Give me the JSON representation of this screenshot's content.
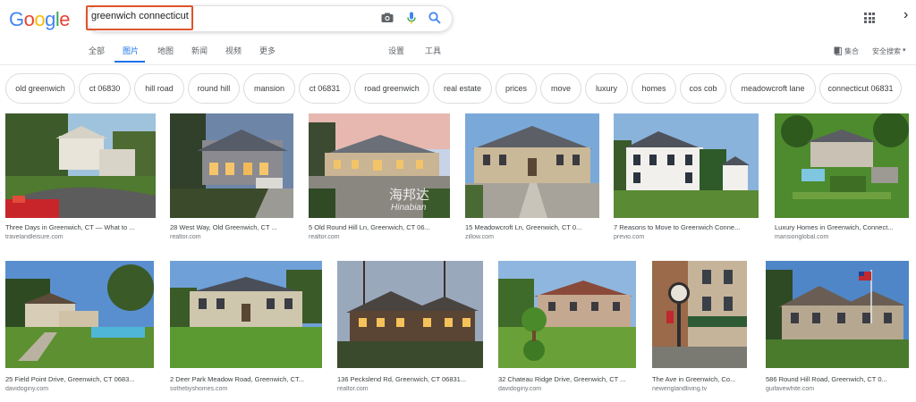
{
  "logo": {
    "letters": [
      "G",
      "o",
      "o",
      "g",
      "l",
      "e"
    ],
    "colors": [
      "#4285f4",
      "#ea4335",
      "#fbbc05",
      "#4285f4",
      "#34a853",
      "#ea4335"
    ]
  },
  "search": {
    "query": "greenwich connecticut"
  },
  "tabs": [
    {
      "label": "全部",
      "active": false
    },
    {
      "label": "图片",
      "active": true
    },
    {
      "label": "地图",
      "active": false
    },
    {
      "label": "新闻",
      "active": false
    },
    {
      "label": "视频",
      "active": false
    },
    {
      "label": "更多",
      "active": false
    },
    {
      "label": "设置",
      "active": false
    },
    {
      "label": "工具",
      "active": false
    }
  ],
  "header_right": {
    "collections": "集合",
    "safesearch": "安全搜索"
  },
  "chips": [
    "old greenwich",
    "ct 06830",
    "hill road",
    "round hill",
    "mansion",
    "ct 06831",
    "road greenwich",
    "real estate",
    "prices",
    "move",
    "luxury",
    "homes",
    "cos cob",
    "meadowcroft lane",
    "connecticut 06831"
  ],
  "results": [
    {
      "caption": "Three Days in Greenwich, CT — What to ...",
      "source": "travelandleisure.com"
    },
    {
      "caption": "28 West Way, Old Greenwich, CT ...",
      "source": "realtor.com"
    },
    {
      "caption": "5 Old Round Hill Ln, Greenwich, CT 06...",
      "source": "realtor.com"
    },
    {
      "caption": "15 Meadowcroft Ln, Greenwich, CT 0...",
      "source": "zillow.com"
    },
    {
      "caption": "7 Reasons to Move to Greenwich Conne...",
      "source": "previo.com"
    },
    {
      "caption": "Luxury Homes in Greenwich, Connect...",
      "source": "mansionglobal.com"
    },
    {
      "caption": "25 Field Point Drive, Greenwich, CT 0683...",
      "source": "davidoginy.com"
    },
    {
      "caption": "2 Deer Park Meadow Road, Greenwich, CT...",
      "source": "sothebyshomes.com"
    },
    {
      "caption": "136 Peckslend Rd, Greenwich, CT 06831...",
      "source": "realtor.com"
    },
    {
      "caption": "32 Chateau Ridge Drive, Greenwich, CT ...",
      "source": "davidoginy.com"
    },
    {
      "caption": "The Ave in Greenwich, Co...",
      "source": "newenglandliving.tv"
    },
    {
      "caption": "586 Round Hill Road, Greenwich, CT 0...",
      "source": "guifavewhite.com"
    }
  ],
  "watermark": {
    "cn": "海邦达",
    "en": "Hinabian"
  }
}
